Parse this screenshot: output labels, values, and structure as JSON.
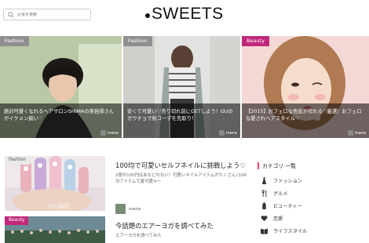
{
  "search": {
    "placeholder": "記事を検索"
  },
  "logo": {
    "text": "SWEETS"
  },
  "hero": [
    {
      "tag": "Fashion",
      "tag_color": "#8f8f8f",
      "caption": "絶対可愛くなれるヘアサロンSHIMAの美容師さんがイケメン揃い♡",
      "author": "mana"
    },
    {
      "tag": "Fashion",
      "tag_color": "#8f8f8f",
      "caption": "安くて可愛い♡売り切れ前にGETしよう！GUのガウチョで秋コーデを先取り！",
      "author": "mana"
    },
    {
      "tag": "Beauty",
      "tag_color": "#c0287a",
      "caption": "【2015】おフェロな色気が作れる♡厳選！おフェロな愛されヘアスタイル♡",
      "author": "mana"
    }
  ],
  "article1": {
    "tag": "Fashion",
    "title": "100均で可愛いセルフネイルに挑戦しよう♡",
    "desc": "2億の100円はあなどれない！可愛いネイルアイテムがたくさん♪100均アイテムで夏可愛ゃ～",
    "author": "mana"
  },
  "article2": {
    "tag": "Beauty",
    "title": "今話題のエアーヨガを調べてみた",
    "desc": "エアーヨガを調べてみた"
  },
  "categories": {
    "heading": "カテゴリ 一覧",
    "items": [
      {
        "label": "ファッション",
        "icon": "dress-icon"
      },
      {
        "label": "グルメ",
        "icon": "utensils-icon"
      },
      {
        "label": "ビューティー",
        "icon": "bottle-icon"
      },
      {
        "label": "恋愛",
        "icon": "heart-icon"
      },
      {
        "label": "ライフスタイル",
        "icon": "book-icon"
      }
    ]
  },
  "colors": {
    "accent": "#e0476a",
    "beauty": "#c0287a",
    "fashion": "#8f8f8f"
  }
}
